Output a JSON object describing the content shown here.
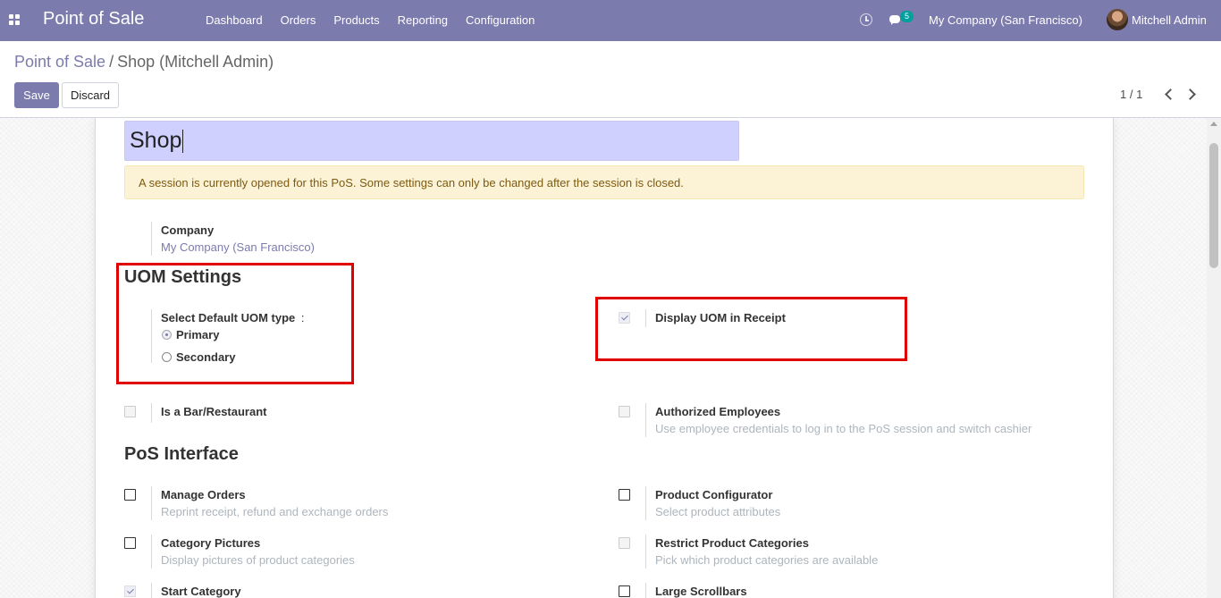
{
  "app": {
    "brand": "Point of Sale"
  },
  "menu": [
    {
      "label": "Dashboard"
    },
    {
      "label": "Orders"
    },
    {
      "label": "Products"
    },
    {
      "label": "Reporting"
    },
    {
      "label": "Configuration"
    }
  ],
  "systray": {
    "messages_count": "5",
    "company": "My Company (San Francisco)",
    "user": "Mitchell Admin"
  },
  "breadcrumb": {
    "parent": "Point of Sale",
    "separator": "/",
    "current": "Shop (Mitchell Admin)"
  },
  "buttons": {
    "save": "Save",
    "discard": "Discard"
  },
  "pager": {
    "value": "1 / 1"
  },
  "form": {
    "name": "Shop",
    "alert": "A session is currently opened for this PoS. Some settings can only be changed after the session is closed.",
    "company": {
      "label": "Company",
      "value": "My Company (San Francisco)"
    },
    "uom_settings": {
      "title": "UOM Settings",
      "select_label": "Select Default UOM type",
      "select_colon": ":",
      "options": [
        {
          "label": "Primary",
          "selected": true
        },
        {
          "label": "Secondary",
          "selected": false
        }
      ],
      "display_uom": {
        "label": "Display UOM in Receipt",
        "checked": true
      }
    },
    "bar_restaurant": {
      "label": "Is a Bar/Restaurant",
      "checked": false
    },
    "authorized_employees": {
      "label": "Authorized Employees",
      "help": "Use employee credentials to log in to the PoS session and switch cashier",
      "checked": false
    },
    "pos_interface": {
      "title": "PoS Interface",
      "manage_orders": {
        "label": "Manage Orders",
        "help": "Reprint receipt, refund and exchange orders",
        "checked": false
      },
      "product_configurator": {
        "label": "Product Configurator",
        "help": "Select product attributes",
        "checked": false
      },
      "category_pictures": {
        "label": "Category Pictures",
        "help": "Display pictures of product categories",
        "checked": false
      },
      "restrict_categories": {
        "label": "Restrict Product Categories",
        "help": "Pick which product categories are available",
        "checked": false
      },
      "start_category": {
        "label": "Start Category",
        "checked": true
      },
      "large_scrollbars": {
        "label": "Large Scrollbars",
        "checked": false
      }
    }
  },
  "colors": {
    "brand": "#7c7bad",
    "highlight_box": "#e00000",
    "alert_bg": "#fcf3d6",
    "name_field_bg": "#d0d0ff"
  }
}
